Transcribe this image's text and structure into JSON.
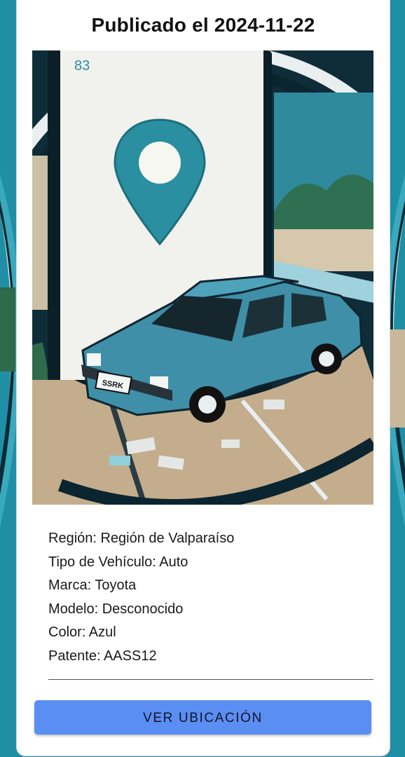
{
  "header": {
    "title": "Publicado el 2024-11-22"
  },
  "image": {
    "plate_text": "SSRK",
    "corner_digits": "83"
  },
  "details": {
    "rows": [
      {
        "label": "Región",
        "value": "Región de Valparaíso",
        "text": "Región: Región de Valparaíso"
      },
      {
        "label": "Tipo de Vehículo",
        "value": "Auto",
        "text": "Tipo de Vehículo: Auto"
      },
      {
        "label": "Marca",
        "value": "Toyota",
        "text": "Marca: Toyota"
      },
      {
        "label": "Modelo",
        "value": "Desconocido",
        "text": "Modelo: Desconocido"
      },
      {
        "label": "Color",
        "value": "Azul",
        "text": "Color: Azul"
      },
      {
        "label": "Patente",
        "value": "AASS12",
        "text": "Patente: AASS12"
      }
    ]
  },
  "actions": {
    "view_location_label": "VER UBICACIÓN"
  },
  "colors": {
    "accent": "#5b8ef2",
    "background": "#1f8fa6",
    "card": "#ffffff",
    "pin": "#2a8fa0",
    "car": "#3f8fa8"
  }
}
